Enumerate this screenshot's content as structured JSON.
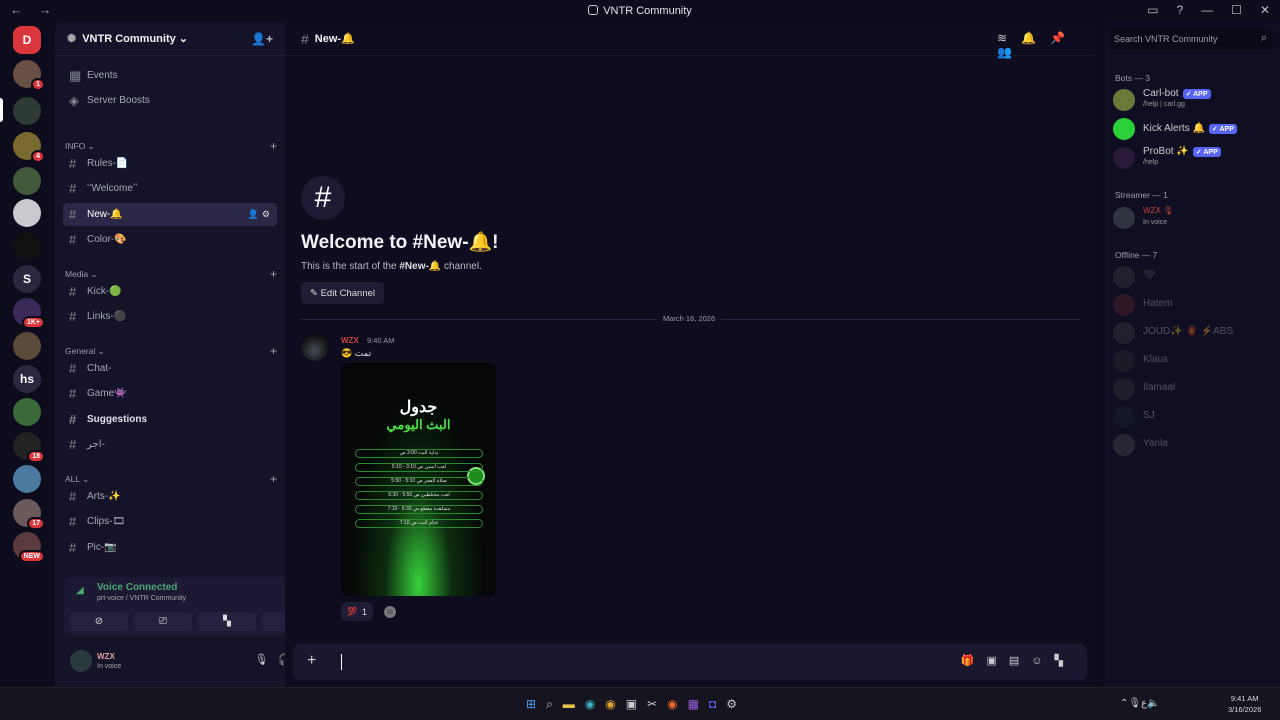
{
  "window": {
    "title": "VNTR Community",
    "nav": "← →",
    "controls": [
      "▭",
      "?",
      "—",
      "☐",
      "✕"
    ]
  },
  "guilds": [
    {
      "label": "D",
      "color": "#da373c",
      "badge": ""
    },
    {
      "label": "",
      "color": "#6a4f45",
      "badge": "1"
    },
    {
      "label": "",
      "color": "#2e3a36",
      "badge": ""
    },
    {
      "label": "",
      "color": "#7a6a30",
      "badge": "4"
    },
    {
      "label": "",
      "color": "#405a3a",
      "badge": ""
    },
    {
      "label": "",
      "color": "#c9cacf",
      "badge": ""
    },
    {
      "label": "",
      "color": "#111111",
      "badge": ""
    },
    {
      "label": "S",
      "color": "#2a2840",
      "badge": ""
    },
    {
      "label": "",
      "color": "#3a2a5a",
      "badge": "1K+"
    },
    {
      "label": "",
      "color": "#5a4a38",
      "badge": ""
    },
    {
      "label": "hs",
      "color": "#2a2840",
      "badge": ""
    },
    {
      "label": "",
      "color": "#3a6a3a",
      "badge": ""
    },
    {
      "label": "",
      "color": "#222222",
      "badge": "18"
    },
    {
      "label": "",
      "color": "#4a7aa0",
      "badge": ""
    },
    {
      "label": "",
      "color": "#6a5a5a",
      "badge": "17"
    },
    {
      "label": "",
      "color": "#5a3a3a",
      "badge": "NEW"
    }
  ],
  "server": {
    "name": "VNTR Community ⌄",
    "add_user_icon": "add-member-icon"
  },
  "top_links": [
    {
      "label": "Events",
      "icon": "calendar-icon"
    },
    {
      "label": "Server Boosts",
      "icon": "boost-icon"
    }
  ],
  "categories": {
    "info": "INFO ⌄",
    "media": "Media ⌄",
    "general": "General ⌄",
    "all": "ALL ⌄"
  },
  "channels": {
    "rules": "Rules-📄",
    "welcome": "ʻʻWelcomeʼʼ",
    "new": "New-🔔",
    "color": "Color-🎨",
    "kick": "Kick-🟢",
    "links": "Links-⚫",
    "chat": "Chat-",
    "game": "Game👾",
    "suggestions": "Suggestions",
    "ajr": "اجر-",
    "arts": "Arts-✨",
    "clips": "Clips-🎞",
    "pic": "Pic-📷"
  },
  "voice": {
    "status": "Voice Connected",
    "location": "prt-voice / VNTR Community"
  },
  "user": {
    "name": "WZX",
    "status": "In voice"
  },
  "chat": {
    "channel": "New-🔔",
    "welcome": "Welcome to #New-🔔!",
    "start_prefix": "This is the start of the ",
    "start_channel": "#New-🔔",
    "start_suffix": " channel.",
    "edit_channel": "✎ Edit Channel",
    "date": "March 16, 2026",
    "message": {
      "author": "WZX",
      "time": "9:40 AM",
      "text": "😎 تمت"
    },
    "poster": {
      "title1": "جدول",
      "title2": "البث اليومي",
      "rows": [
        "بداية البث 3:00 ص",
        "لعب أسبي ص 3:10 - 5:10",
        "صلاة الفجر ص 5:10 - 5:50",
        "لعب مختلطين ص 5:50 - 6:30",
        "مشاهدة مقطع ص 6:30 - 7:10",
        "ختام البث ص 7:10"
      ]
    },
    "reaction": {
      "emoji": "💯",
      "count": "1"
    }
  },
  "members": {
    "search_placeholder": "Search VNTR Community",
    "bots_header": "Bots — 3",
    "bots": [
      {
        "name": "Carl-bot",
        "sub": "/help | carl.gg",
        "badge": "✓ APP",
        "color": "#6a7a3a"
      },
      {
        "name": "Kick Alerts 🔔",
        "sub": "",
        "badge": "✓ APP",
        "color": "#2ad13a"
      },
      {
        "name": "ProBot ✨",
        "sub": "/help",
        "badge": "✓ APP",
        "color": "#2a1a3a"
      }
    ],
    "streamer_header": "Streamer — 1",
    "streamer": {
      "name": "WZX 🎙",
      "sub": "In voice"
    },
    "offline_header": "Offline — 7",
    "offline": [
      "🖤",
      "Hatem",
      "JOUD✨ 🏮 ⚡ABS",
      "Klaus",
      "Ilamaal",
      "SJ",
      "Yanla"
    ]
  },
  "taskbar": {
    "time": "9:41 AM",
    "date": "3/16/2026",
    "lang": "ع"
  }
}
